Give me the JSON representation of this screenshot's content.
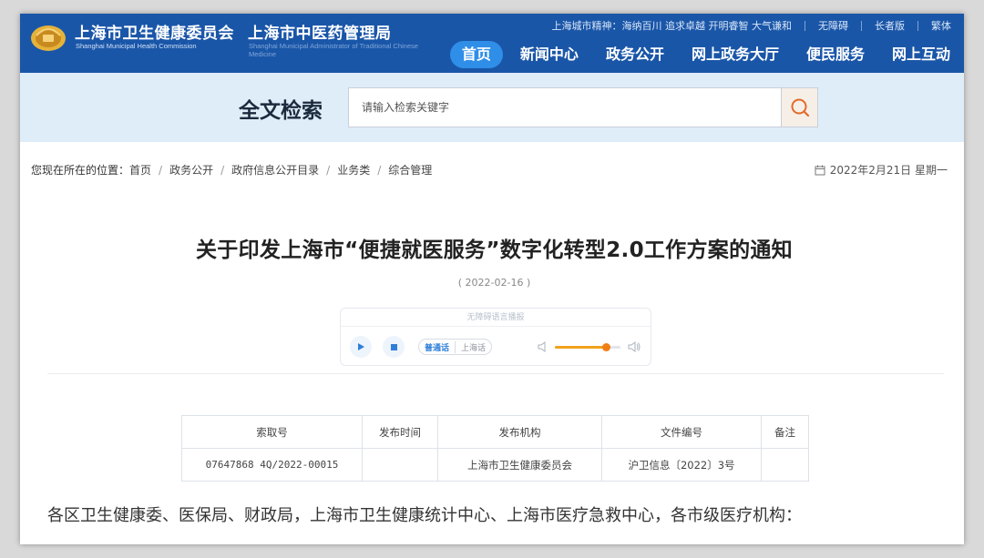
{
  "header": {
    "org_name": "上海市卫生健康委员会",
    "org_name_en": "Shanghai Municipal Health Commission",
    "org2_name": "上海市中医药管理局",
    "org2_name_en": "Shanghai Municipal Administrator of Traditional Chinese Medicine",
    "city_spirit": "上海城市精神：海纳百川 追求卓越 开明睿智 大气谦和",
    "util_links": [
      "无障碍",
      "长者版",
      "繁体"
    ],
    "nav": [
      "首页",
      "新闻中心",
      "政务公开",
      "网上政务大厅",
      "便民服务",
      "网上互动"
    ],
    "colors": {
      "header_bg": "#1a56a8",
      "nav_active": "#2f8ee8"
    }
  },
  "search": {
    "title": "全文检索",
    "placeholder": "请输入检索关键字",
    "button_icon": "search-icon"
  },
  "breadcrumb": {
    "label": "您现在所在的位置：",
    "items": [
      "首页",
      "政务公开",
      "政府信息公开目录",
      "业务类",
      "综合管理"
    ]
  },
  "current_date": "2022年2月21日 星期一",
  "article": {
    "title": "关于印发上海市“便捷就医服务”数字化转型2.0工作方案的通知",
    "pub_date": "( 2022-02-16 )",
    "player": {
      "header": "无障碍语言播报",
      "lang_primary": "普通话",
      "lang_secondary": "上海话",
      "volume_fraction": 0.78
    },
    "info_table": {
      "headers": [
        "索取号",
        "发布时间",
        "发布机构",
        "文件编号",
        "备注"
      ],
      "row": [
        "07647868 4Q/2022-00015",
        "",
        "上海市卫生健康委员会",
        "沪卫信息〔2022〕3号",
        ""
      ]
    },
    "salutation": "各区卫生健康委、医保局、财政局，上海市卫生健康统计中心、上海市医疗急救中心，各市级医疗机构："
  }
}
